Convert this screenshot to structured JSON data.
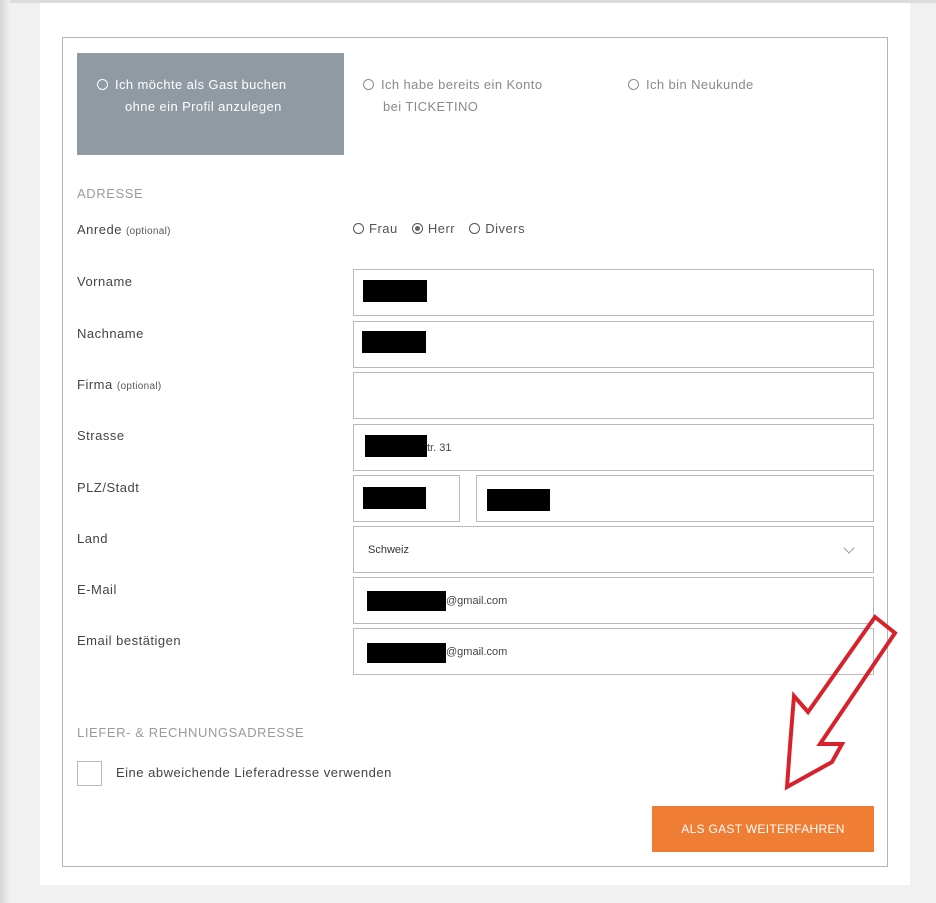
{
  "account_options": {
    "guest": {
      "line1": "Ich möchte als Gast buchen",
      "line2": "ohne ein Profil anzulegen"
    },
    "existing": {
      "line1": "Ich habe bereits ein Konto",
      "line2": "bei TICKETINO"
    },
    "new": {
      "line1": "Ich bin Neukunde"
    }
  },
  "address": {
    "section_title": "ADRESSE",
    "salutation": {
      "label": "Anrede",
      "optional": "(optional)",
      "options": [
        "Frau",
        "Herr",
        "Divers"
      ],
      "selected": "Herr"
    },
    "firstname_label": "Vorname",
    "lastname_label": "Nachname",
    "company_label": "Firma",
    "company_optional": "(optional)",
    "street_label": "Strasse",
    "street_value_suffix": "tr. 31",
    "zip_city_label": "PLZ/Stadt",
    "country_label": "Land",
    "country_value": "Schweiz",
    "email_label": "E-Mail",
    "email_value_suffix": "@gmail.com",
    "email_confirm_label": "Email bestätigen",
    "email_confirm_value_suffix": "@gmail.com"
  },
  "delivery": {
    "section_title": "LIEFER- & RECHNUNGSADRESSE",
    "different_address_label": "Eine abweichende Lieferadresse verwenden",
    "different_address_checked": false
  },
  "continue_button_label": "ALS GAST WEITERFAHREN",
  "colors": {
    "active_option_bg": "#8f9aa2",
    "button_bg": "#ef7d33",
    "annotation_arrow": "#d8222b"
  }
}
